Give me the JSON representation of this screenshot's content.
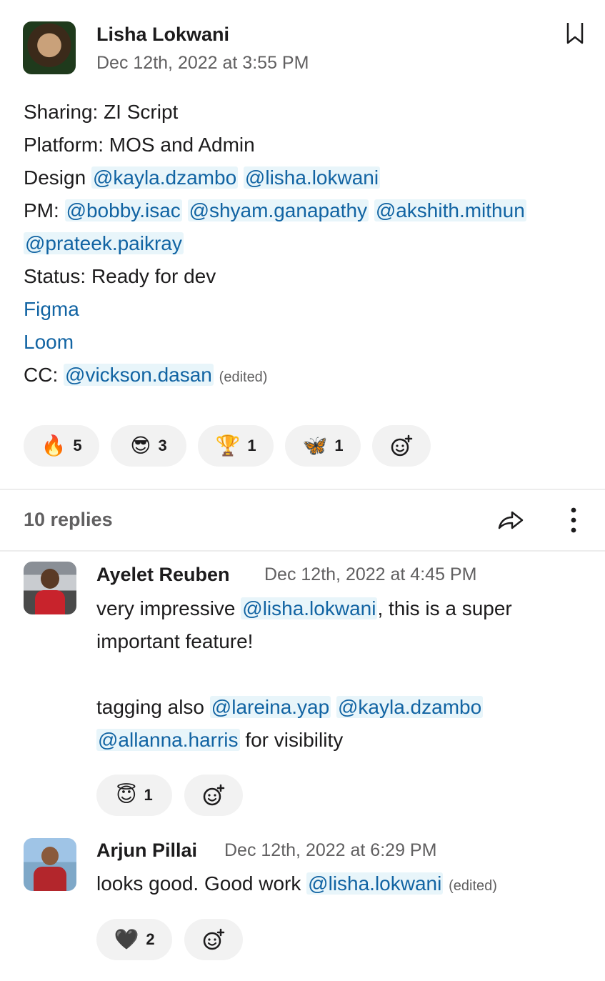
{
  "message": {
    "author": "Lisha Lokwani",
    "timestamp": "Dec 12th, 2022 at 3:55 PM",
    "header_icon": "bookmark-icon",
    "lines": {
      "sharing": "Sharing: ZI Script",
      "platform": "Platform: MOS and Admin",
      "design_label": "Design",
      "design_mentions": [
        "@kayla.dzambo",
        "@lisha.lokwani"
      ],
      "pm_label": "PM:",
      "pm_mentions": [
        "@bobby.isac",
        "@shyam.ganapathy",
        "@akshith.mithun",
        "@prateek.paikray"
      ],
      "status": "Status: Ready for dev",
      "link_figma": "Figma",
      "link_loom": "Loom",
      "cc_label": "CC:",
      "cc_mention": "@vickson.dasan",
      "edited": "(edited)"
    },
    "reactions": [
      {
        "emoji": "🔥",
        "name": "fire-emoji",
        "count": "5"
      },
      {
        "emoji": "😎",
        "name": "cool-emoji",
        "count": "3"
      },
      {
        "emoji": "🏆",
        "name": "trophy-emoji",
        "count": "1"
      },
      {
        "emoji": "🦋",
        "name": "butterfly-emoji",
        "count": "1"
      }
    ]
  },
  "thread": {
    "replies_label": "10 replies",
    "share_icon": "share-arrow-icon",
    "more_icon": "more-vertical-icon"
  },
  "replies": [
    {
      "author": "Ayelet Reuben",
      "timestamp": "Dec 12th, 2022 at 4:45 PM",
      "l1_a": "very impressive",
      "l1_mention": "@lisha.lokwani",
      "l1_b": ", this is a super",
      "l2": "important  feature!",
      "l3_a": "tagging also",
      "l3_mentions": [
        "@lareina.yap",
        "@kayla.dzambo"
      ],
      "l4_mention": "@allanna.harris",
      "l4_b": "for visibility",
      "reactions": [
        {
          "emoji": "😇",
          "name": "halo-emoji",
          "count": "1"
        }
      ]
    },
    {
      "author": "Arjun Pillai",
      "timestamp": "Dec 12th, 2022 at 6:29 PM",
      "l1_a": "looks good. Good work",
      "l1_mention": "@lisha.lokwani",
      "edited": "(edited)",
      "reactions": [
        {
          "emoji": "🖤",
          "name": "black-heart-emoji",
          "count": "2"
        }
      ]
    }
  ]
}
